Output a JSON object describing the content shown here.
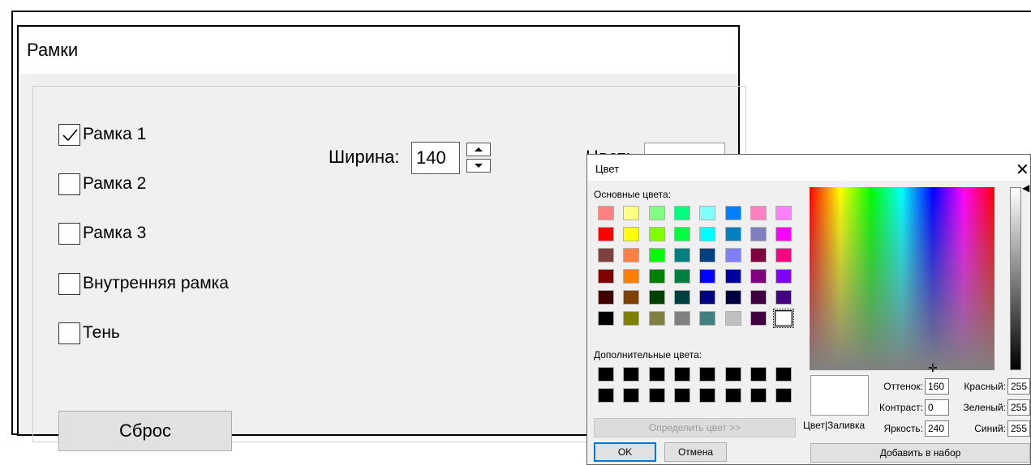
{
  "panel": {
    "title": "Рамки",
    "checkboxes": [
      {
        "label": "Рамка 1",
        "checked": true
      },
      {
        "label": "Рамка 2",
        "checked": false
      },
      {
        "label": "Рамка 3",
        "checked": false
      },
      {
        "label": "Внутренняя рамка",
        "checked": false
      },
      {
        "label": "Тень",
        "checked": false
      }
    ],
    "width_label": "Ширина:",
    "width_value": "140",
    "color_label": "Цвет:",
    "reset_label": "Сброс"
  },
  "dialog": {
    "title": "Цвет",
    "close_glyph": "✕",
    "basic_colors_label": "Основные цвета:",
    "basic_colors": [
      "#ff8080",
      "#ffff80",
      "#80ff80",
      "#00ff80",
      "#80ffff",
      "#0080ff",
      "#ff80c0",
      "#ff80ff",
      "#ff0000",
      "#ffff00",
      "#80ff00",
      "#00ff40",
      "#00ffff",
      "#0080c0",
      "#8080c0",
      "#ff00ff",
      "#804040",
      "#ff8040",
      "#00ff00",
      "#008080",
      "#004080",
      "#8080ff",
      "#800040",
      "#ff0080",
      "#800000",
      "#ff8000",
      "#008000",
      "#008040",
      "#0000ff",
      "#0000a0",
      "#800080",
      "#8000ff",
      "#400000",
      "#804000",
      "#004000",
      "#004040",
      "#000080",
      "#000040",
      "#400040",
      "#400080",
      "#000000",
      "#808000",
      "#808040",
      "#808080",
      "#408080",
      "#c0c0c0",
      "#400040",
      "#ffffff"
    ],
    "custom_colors_label": "Дополнительные цвета:",
    "custom_colors": [
      "#000000",
      "#000000",
      "#000000",
      "#000000",
      "#000000",
      "#000000",
      "#000000",
      "#000000",
      "#000000",
      "#000000",
      "#000000",
      "#000000",
      "#000000",
      "#000000",
      "#000000",
      "#000000"
    ],
    "define_button": "Определить цвет >>",
    "ok_button": "OK",
    "cancel_button": "Отмена",
    "color_fill_label": "Цвет|Заливка",
    "hue_label": "Оттенок:",
    "hue_value": "160",
    "sat_label": "Контраст:",
    "sat_value": "0",
    "lum_label": "Яркость:",
    "lum_value": "240",
    "red_label": "Красный:",
    "red_value": "255",
    "green_label": "Зеленый:",
    "green_value": "255",
    "blue_label": "Синий:",
    "blue_value": "255",
    "add_button": "Добавить в набор"
  }
}
